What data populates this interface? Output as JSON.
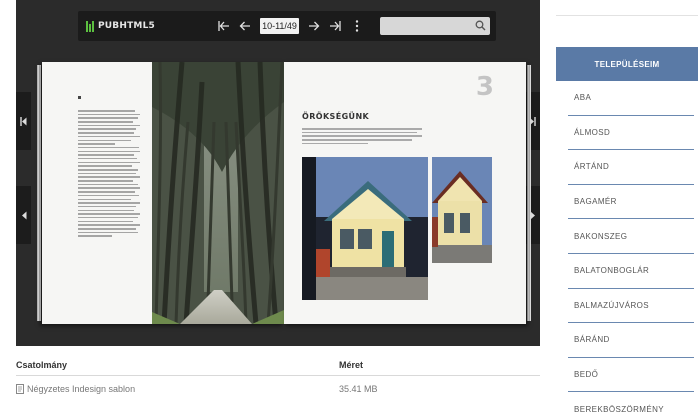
{
  "viewer": {
    "logo": "PUBHTML5",
    "page_indicator": "10-11/49",
    "search_placeholder": "",
    "icons": [
      "first-page-icon",
      "prev-page-icon",
      "next-page-icon",
      "last-page-icon",
      "more-options-icon",
      "search-icon"
    ],
    "book": {
      "right_page_number": "3",
      "right_section_title": "ÖRÖKSÉGÜNK"
    }
  },
  "attachments": {
    "header_name": "Csatolmány",
    "header_size": "Méret",
    "files": [
      {
        "name": "Négyzetes Indesign sablon",
        "size": "35.41 MB"
      }
    ]
  },
  "sidebar": {
    "title": "TELEPÜLÉSEIM",
    "items": [
      "ABA",
      "ÁLMOSD",
      "ÁRTÁND",
      "BAGAMÉR",
      "BAKONSZEG",
      "BALATONBOGLÁR",
      "BALMAZÚJVÁROS",
      "BÁRÁND",
      "BEDŐ",
      "BEREKBÖSZÖRMÉNY"
    ]
  }
}
